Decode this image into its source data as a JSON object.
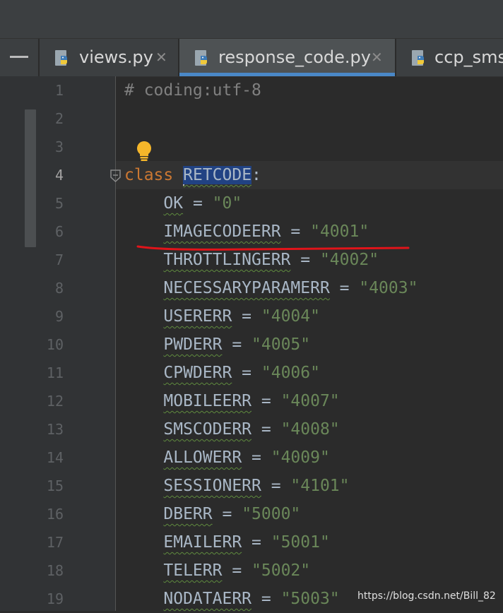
{
  "tabs": [
    {
      "label": "views.py",
      "active": false,
      "closable": true
    },
    {
      "label": "response_code.py",
      "active": true,
      "closable": true
    },
    {
      "label": "ccp_sms.",
      "active": false,
      "closable": false
    }
  ],
  "editor": {
    "current_line": 4,
    "lines": [
      {
        "n": "1",
        "comment": "# coding:utf-8"
      },
      {
        "n": "2"
      },
      {
        "n": "3"
      },
      {
        "n": "4",
        "keyword": "class",
        "classname": "RETCODE",
        "suffix": ":"
      },
      {
        "n": "5",
        "name": "OK",
        "value": "\"0\""
      },
      {
        "n": "6",
        "name": "IMAGECODEERR",
        "value": "\"4001\""
      },
      {
        "n": "7",
        "name": "THROTTLINGERR",
        "value": "\"4002\""
      },
      {
        "n": "8",
        "name": "NECESSARYPARAMERR",
        "value": "\"4003\""
      },
      {
        "n": "9",
        "name": "USERERR",
        "value": "\"4004\""
      },
      {
        "n": "10",
        "name": "PWDERR",
        "value": "\"4005\""
      },
      {
        "n": "11",
        "name": "CPWDERR",
        "value": "\"4006\""
      },
      {
        "n": "12",
        "name": "MOBILEERR",
        "value": "\"4007\""
      },
      {
        "n": "13",
        "name": "SMSCODERR",
        "value": "\"4008\""
      },
      {
        "n": "14",
        "name": "ALLOWERR",
        "value": "\"4009\""
      },
      {
        "n": "15",
        "name": "SESSIONERR",
        "value": "\"4101\""
      },
      {
        "n": "16",
        "name": "DBERR",
        "value": "\"5000\""
      },
      {
        "n": "17",
        "name": "EMAILERR",
        "value": "\"5001\""
      },
      {
        "n": "18",
        "name": "TELERR",
        "value": "\"5002\""
      },
      {
        "n": "19",
        "name": "NODATAERR",
        "value": "\"5003\""
      }
    ]
  },
  "watermark": "https://blog.csdn.net/Bill_82",
  "icons": {
    "tab_file": "python-file-icon",
    "intention": "lightbulb-icon",
    "fold": "fold-marker-icon",
    "close": "close-icon"
  },
  "colors": {
    "keyword": "#cc7832",
    "string": "#6a8759",
    "comment": "#808080",
    "selection": "#214283",
    "tab_accent": "#4a88c7",
    "annotation": "#e0141a"
  }
}
